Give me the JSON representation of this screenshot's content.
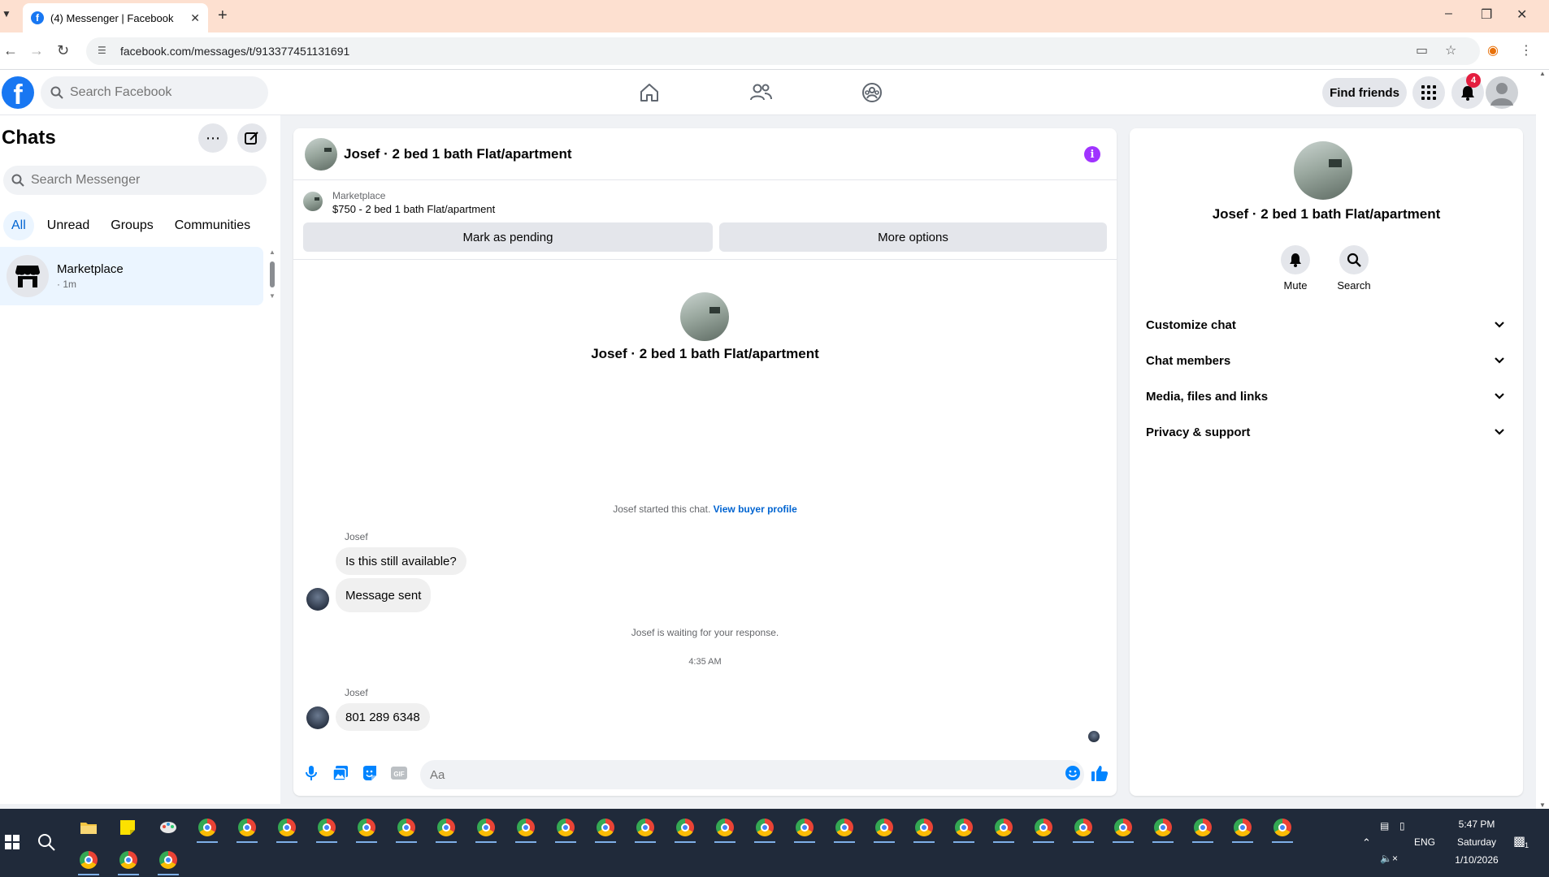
{
  "browser": {
    "tab_title": "(4) Messenger | Facebook",
    "url": "facebook.com/messages/t/913377451131691"
  },
  "header": {
    "search_placeholder": "Search Facebook",
    "find_friends": "Find friends",
    "notification_count": "4"
  },
  "chats": {
    "title": "Chats",
    "search_placeholder": "Search Messenger",
    "filters": [
      "All",
      "Unread",
      "Groups",
      "Communities"
    ],
    "list": [
      {
        "name": "Marketplace",
        "time": "· 1m"
      }
    ]
  },
  "conversation": {
    "title": "Josef · 2 bed 1 bath Flat/apartment",
    "marketplace_label": "Marketplace",
    "listing": "$750 - 2 bed 1 bath Flat/apartment",
    "mark_pending": "Mark as pending",
    "more_options": "More options",
    "profile_name": "Josef · 2 bed 1 bath Flat/apartment",
    "started_text": "Josef started this chat.",
    "buyer_profile_link": "View buyer profile",
    "messages": [
      {
        "sender": "Josef",
        "text": "Is this still available?"
      },
      {
        "sender": "",
        "text": "Message sent"
      },
      {
        "sender": "Josef",
        "text": "801 289 6348"
      }
    ],
    "waiting_text": "Josef is waiting for your response.",
    "timestamp": "4:35 AM",
    "input_placeholder": "Aa"
  },
  "info_panel": {
    "name": "Josef · 2 bed 1 bath Flat/apartment",
    "actions": [
      "Mute",
      "Search"
    ],
    "sections": [
      "Customize chat",
      "Chat members",
      "Media, files and links",
      "Privacy & support"
    ]
  },
  "taskbar": {
    "time": "5:47 PM",
    "day": "Saturday",
    "date": "1/10/2026",
    "lang": "ENG",
    "notif": "1"
  },
  "colors": {
    "fb_blue": "#1877f2",
    "link_blue": "#0064d1",
    "info_purple": "#a033ff",
    "badge_red": "#e41e3f",
    "active_chat_bg": "#ebf5ff"
  }
}
